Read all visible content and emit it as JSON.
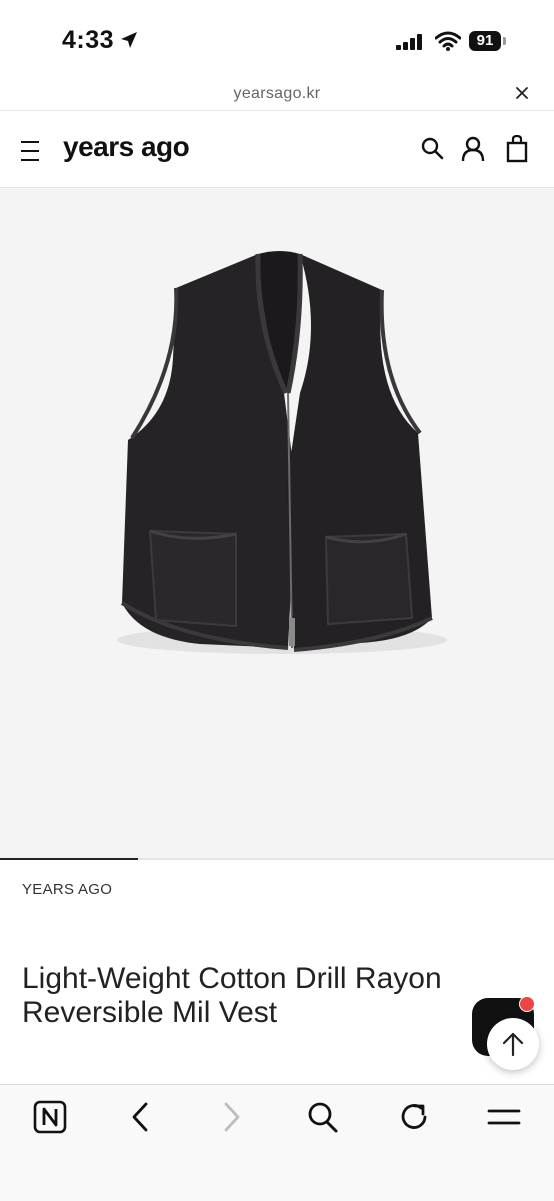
{
  "status_bar": {
    "time": "4:33",
    "battery": "91",
    "icons": [
      "location-arrow-icon",
      "signal-icon",
      "wifi-icon",
      "battery-icon"
    ]
  },
  "url_bar": {
    "url": "yearsago.kr",
    "close_icon": "close-icon"
  },
  "header": {
    "logo": "years ago",
    "icons": [
      "menu-icon",
      "search-icon",
      "account-icon",
      "shopping-bag-icon"
    ]
  },
  "product": {
    "image": "black-vest-product-photo",
    "image_position": "1 of 4",
    "brand": "YEARS AGO",
    "title_line1": "Light-Weight Cotton Drill Rayon",
    "title_line2": "Reversible Mil Vest"
  },
  "floating": {
    "chat_icon": "chat-icon",
    "scroll_top_icon": "arrow-up-icon",
    "badge_color": "#ef4444"
  },
  "toolbar": {
    "items": [
      "naver-home-icon",
      "back-icon",
      "forward-icon",
      "search-icon",
      "reload-icon",
      "menu-icon"
    ]
  }
}
